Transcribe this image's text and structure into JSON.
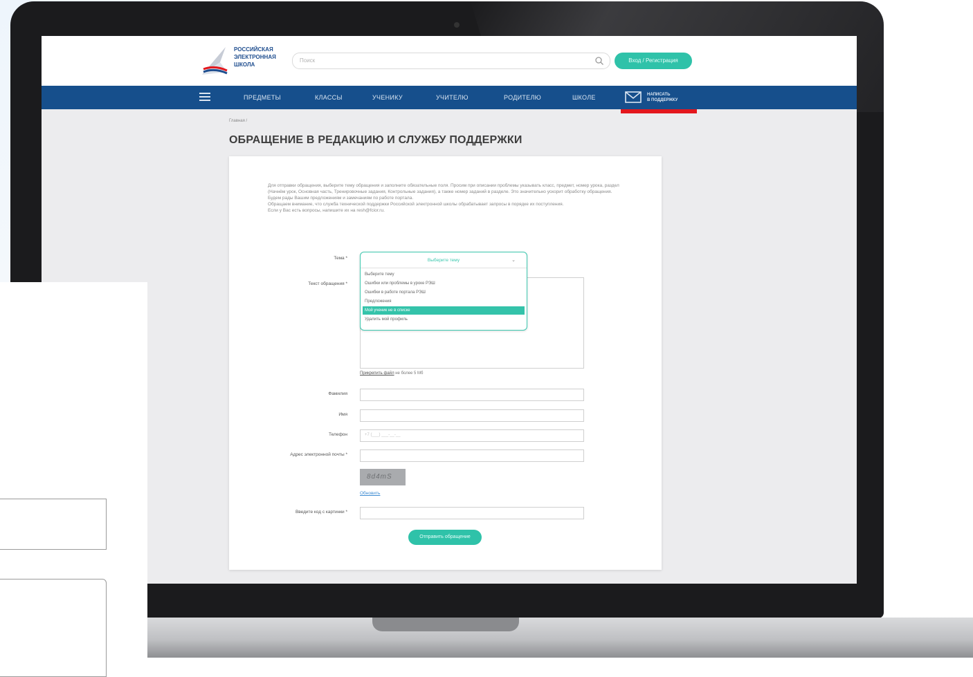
{
  "site": {
    "logo_lines": [
      "РОССИЙСКАЯ",
      "ЭЛЕКТРОННАЯ",
      "ШКОЛА"
    ],
    "search_placeholder": "Поиск",
    "login_label": "Вход / Регистрация",
    "nav": [
      "ПРЕДМЕТЫ",
      "КЛАССЫ",
      "УЧЕНИКУ",
      "УЧИТЕЛЮ",
      "РОДИТЕЛЮ",
      "ШКОЛЕ"
    ],
    "support_lines": [
      "НАПИСАТЬ",
      "В ПОДДЕРЖКУ"
    ],
    "accent_color": "#2fc2a9",
    "nav_color": "#164f8c",
    "highlight_color": "#e3171d"
  },
  "page": {
    "breadcrumb": "Главная /",
    "title": "ОБРАЩЕНИЕ В РЕДАКЦИЮ И СЛУЖБУ ПОДДЕРЖКИ",
    "intro": [
      "Для отправки обращения, выберите тему обращения и заполните обязательные поля. Просим при описании проблемы указывать класс, предмет, номер урока, раздел (Начнём урок, Основная часть, Тренировочные задания, Контрольные задания), а также номер заданий в разделе. Это значительно ускорит обработку обращения. Будем рады Вашим предложениям и замечаниям по работе портала.",
      "Обращаем внимание, что служба технической поддержки Российской электронной школы обрабатывает запросы в порядке их поступления.",
      "Если у Вас есть вопросы, напишите их на resh@fcior.ru."
    ]
  },
  "form": {
    "topic_label": "Тема *",
    "topic_selected": "Выберите тему",
    "topic_options": [
      "Выберите тему",
      "Ошибки или проблемы в уроке РЭШ",
      "Ошибки в работе портала РЭШ",
      "Предложения",
      "Мой ученик не в списке",
      "Удалить мой профиль"
    ],
    "topic_active_index": 4,
    "message_label": "Текст обращения *",
    "attach_link": "Прикрепить файл",
    "attach_note": " не более 5 Мб",
    "surname_label": "Фамилия",
    "name_label": "Имя",
    "phone_label": "Телефон",
    "phone_placeholder": "+7 (___) ___-__-__",
    "email_label": "Адрес электронной почты *",
    "captcha_text": "8d4mS",
    "refresh_link": "Обновить",
    "captcha_label": "Введите код с картинки *",
    "submit_label": "Отправить обращение"
  }
}
